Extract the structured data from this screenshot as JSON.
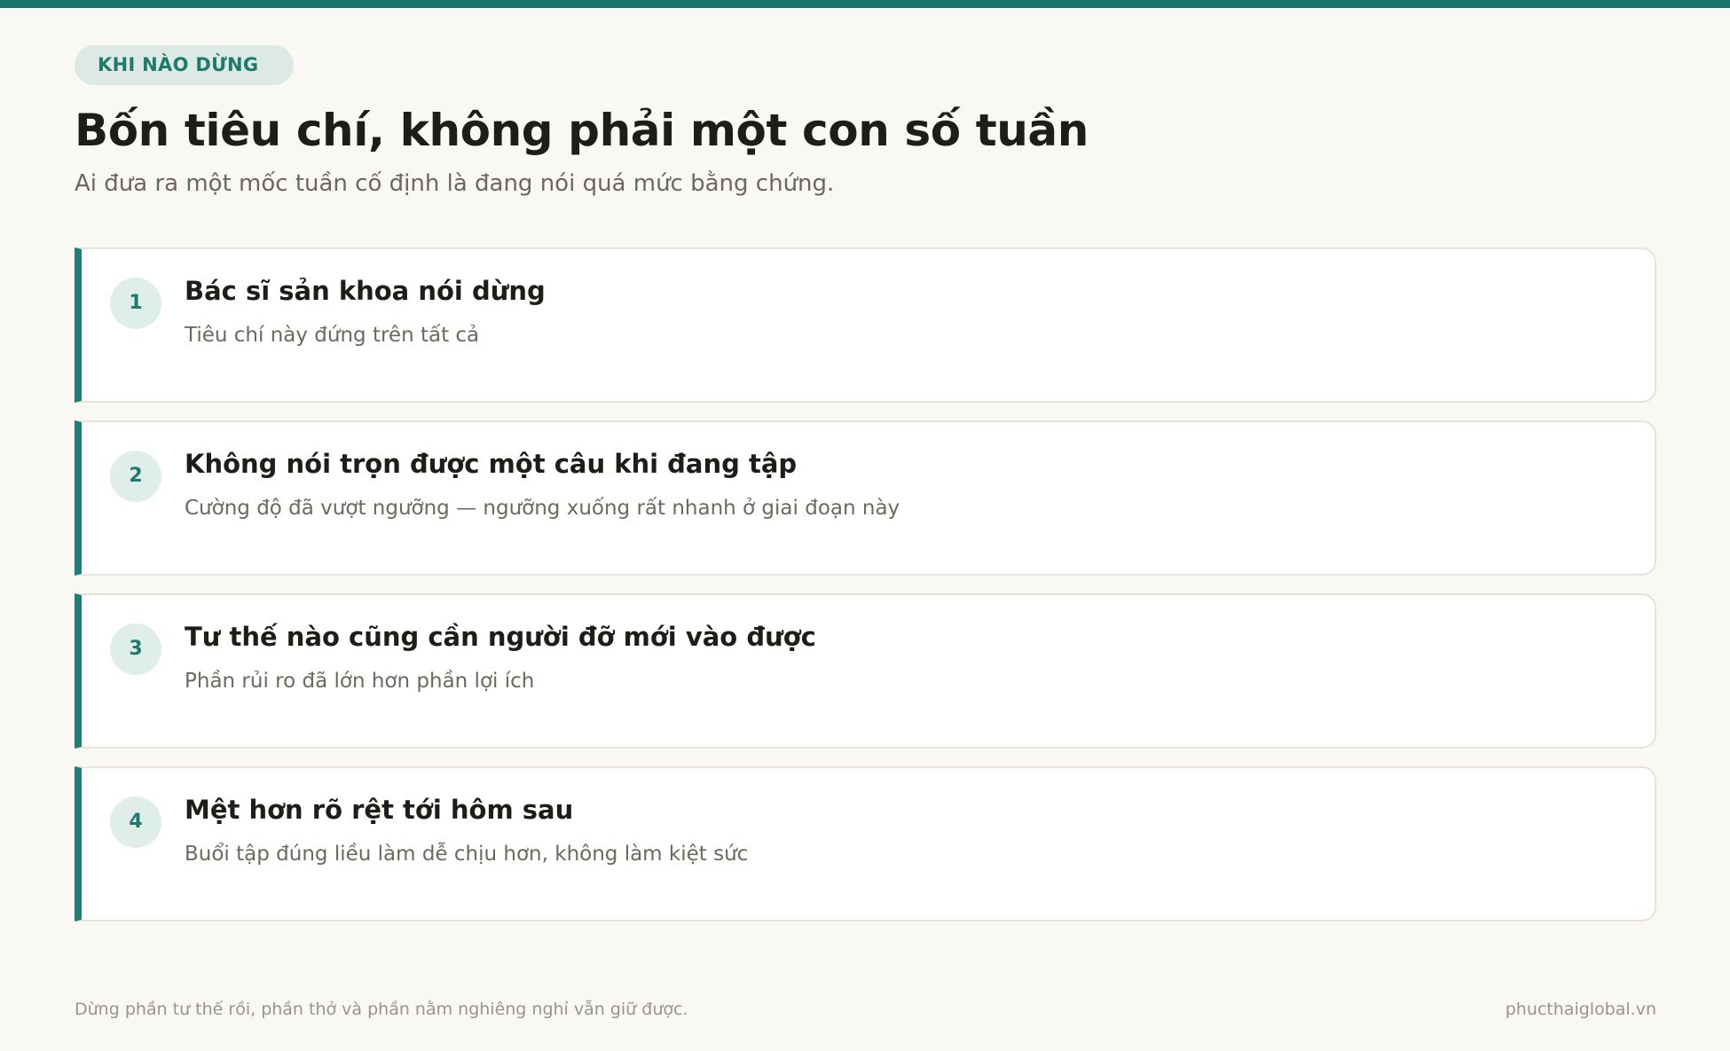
{
  "colors": {
    "accent": "#16766b",
    "background": "#faf8f4",
    "badge_background": "#dde9e4",
    "card_background": "#ffffff",
    "card_border": "#e7e3da"
  },
  "header": {
    "eyebrow": "KHI NÀO DỪNG",
    "title": "Bốn tiêu chí, không phải một con số tuần",
    "subtitle": "Ai đưa ra một mốc tuần cố định là đang nói quá mức bằng chứng."
  },
  "criteria": [
    {
      "number": "1",
      "title": "Bác sĩ sản khoa nói dừng",
      "description": "Tiêu chí này đứng trên tất cả"
    },
    {
      "number": "2",
      "title": "Không nói trọn được một câu khi đang tập",
      "description": "Cường độ đã vượt ngưỡng — ngưỡng xuống rất nhanh ở giai đoạn này"
    },
    {
      "number": "3",
      "title": "Tư thế nào cũng cần người đỡ mới vào được",
      "description": "Phần rủi ro đã lớn hơn phần lợi ích"
    },
    {
      "number": "4",
      "title": "Mệt hơn rõ rệt tới hôm sau",
      "description": "Buổi tập đúng liều làm dễ chịu hơn, không làm kiệt sức"
    }
  ],
  "footer": {
    "note": "Dừng phần tư thế rồi, phần thở và phần nằm nghiêng nghỉ vẫn giữ được.",
    "site": "phucthaiglobal.vn"
  }
}
